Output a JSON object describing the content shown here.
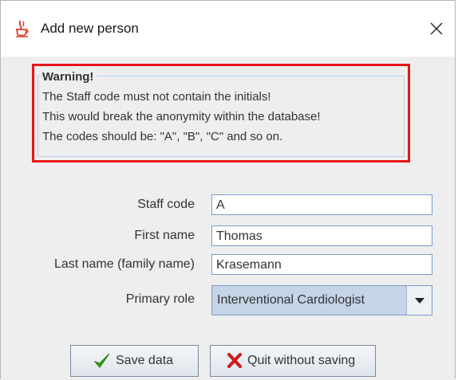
{
  "window": {
    "title": "Add new person",
    "app_icon": "java-cup-icon",
    "close_icon": "close-icon"
  },
  "warning": {
    "heading": "Warning!",
    "lines": [
      "The Staff code must not contain the initials!",
      "This would break the anonymity within the database!",
      "The codes should be: \"A\", \"B\", \"C\" and so on."
    ],
    "border_color": "#e8131b"
  },
  "form": {
    "staff_code": {
      "label": "Staff code",
      "value": "A"
    },
    "first_name": {
      "label": "First name",
      "value": "Thomas"
    },
    "last_name": {
      "label": "Last name (family name)",
      "value": "Krasemann"
    },
    "primary_role": {
      "label": "Primary role",
      "value": "Interventional Cardiologist"
    }
  },
  "buttons": {
    "save": {
      "label": "Save data",
      "icon": "checkmark-icon",
      "icon_color": "#3aa318"
    },
    "quit": {
      "label": "Quit without saving",
      "icon": "x-mark-icon",
      "icon_color": "#d11a1a"
    }
  }
}
